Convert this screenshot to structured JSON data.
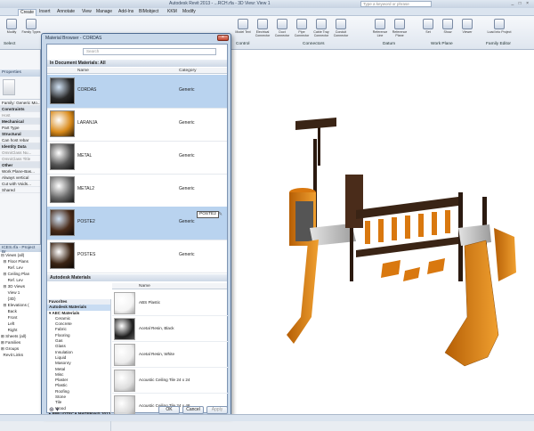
{
  "app": {
    "title": "Autodesk Revit 2013 - ...RCH.rfa - 3D View: View 1",
    "search_placeholder": "Type a keyword or phrase",
    "window_buttons": "_ □ ×"
  },
  "menu": [
    "Create",
    "Insert",
    "Annotate",
    "View",
    "Manage",
    "Add-Ins",
    "BIMobject",
    "KKM",
    "Modify"
  ],
  "ribbon": {
    "buttons": [
      "Modify",
      "Family Types",
      "",
      "",
      "Model Text",
      "Model Line",
      "Component",
      "Model Group",
      "Detail",
      "Symbolic Line",
      "Connector",
      "",
      "Electrical Connector",
      "Duct Connector",
      "Pipe Connector",
      "Cable Tray Connector",
      "Conduit Connector",
      "Reference Line",
      "Reference Plane",
      "Set",
      "Show",
      "Viewer",
      "Load into Project"
    ],
    "groups": [
      "Select",
      "Properties",
      "Control",
      "Connectors",
      "Datum",
      "Work Plane",
      "Family Editor"
    ]
  },
  "properties": {
    "header": "Properties",
    "type_selector": "Family: Generic Mo...",
    "rows": [
      {
        "t": "Constraints",
        "k": "sec"
      },
      {
        "t": "Host",
        "k": "gray"
      },
      {
        "t": "Mechanical",
        "k": "sec"
      },
      {
        "t": "Part Type",
        "k": ""
      },
      {
        "t": "Structural",
        "k": "sec"
      },
      {
        "t": "Can host rebar",
        "k": ""
      },
      {
        "t": "Identity Data",
        "k": "sec"
      },
      {
        "t": "OmniClass Nu...",
        "k": "gray"
      },
      {
        "t": "OmniClass Title",
        "k": "gray"
      },
      {
        "t": "Other",
        "k": "sec"
      },
      {
        "t": "Work Plane-Bas...",
        "k": ""
      },
      {
        "t": "Always vertical",
        "k": ""
      },
      {
        "t": "Cut with Voids...",
        "k": ""
      },
      {
        "t": "Shared",
        "k": ""
      }
    ],
    "help_link": "Properties help"
  },
  "project_browser": {
    "header": "ICES.rfa - Project Br",
    "items": [
      "⊟ Views (all)",
      "  ⊟ Floor Plans",
      "      Ref. Lev",
      "  ⊟ Ceiling Plan",
      "      Ref. Lev",
      "  ⊟ 3D Views",
      "      View 1",
      "      {3D}",
      "  ⊟ Elevations (",
      "      Back",
      "      Front",
      "      Left",
      "      Right",
      "⊞ Sheets (all)",
      "⊞ Families",
      "⊞ Groups",
      "  Revit Links"
    ]
  },
  "material_browser": {
    "title": "Material Browser - CORDAS",
    "close": "×",
    "search_placeholder": "Search",
    "doc_section": "In Document Materials: All",
    "col_name": "Name",
    "col_category": "Category",
    "doc_materials": [
      {
        "name": "CORDAS",
        "category": "Generic",
        "swatch": "#2a2a2a",
        "selected": true
      },
      {
        "name": "LARANJA",
        "category": "Generic",
        "swatch": "#d98a1a",
        "selected": false
      },
      {
        "name": "METAL",
        "category": "Generic",
        "swatch": "#555555",
        "selected": false
      },
      {
        "name": "METAL2",
        "category": "Generic",
        "swatch": "#6a6a6a",
        "selected": false
      },
      {
        "name": "POSTE2",
        "category": "Generic",
        "swatch": "#4a2c1a",
        "selected": true
      },
      {
        "name": "POSTES",
        "category": "Generic",
        "swatch": "#3b2414",
        "selected": false
      }
    ],
    "tooltip": "POSTE2",
    "lib_section": "Autodesk Materials",
    "lib_tree": [
      {
        "t": "Favorites",
        "k": "hdr"
      },
      {
        "t": "Autodesk Materials",
        "k": "hdr sel"
      },
      {
        "t": "▾ AEC Materials",
        "k": "b"
      },
      {
        "t": "Ceramic",
        "k": "sub"
      },
      {
        "t": "Concrete",
        "k": "sub"
      },
      {
        "t": "Fabric",
        "k": "sub"
      },
      {
        "t": "Flooring",
        "k": "sub"
      },
      {
        "t": "Gas",
        "k": "sub"
      },
      {
        "t": "Glass",
        "k": "sub"
      },
      {
        "t": "Insulation",
        "k": "sub"
      },
      {
        "t": "Liquid",
        "k": "sub"
      },
      {
        "t": "Masonry",
        "k": "sub"
      },
      {
        "t": "Metal",
        "k": "sub"
      },
      {
        "t": "Misc",
        "k": "sub"
      },
      {
        "t": "Plaster",
        "k": "sub"
      },
      {
        "t": "Plastic",
        "k": "sub"
      },
      {
        "t": "Roofing",
        "k": "sub"
      },
      {
        "t": "Stone",
        "k": "sub"
      },
      {
        "t": "Tile",
        "k": "sub"
      },
      {
        "t": "Wood",
        "k": "sub"
      },
      {
        "t": "▸ BIBLIOTECA MATERIAIS 2013",
        "k": "b"
      }
    ],
    "lib_materials": [
      {
        "name": "ABS Plastic",
        "swatch": "#f4f4f4"
      },
      {
        "name": "Acetal Resin, Black",
        "swatch": "#1e1e1e"
      },
      {
        "name": "Acetal Resin, White",
        "swatch": "#ececec"
      },
      {
        "name": "Acoustic Ceiling Tile 24 x 24",
        "swatch": "#dedede"
      },
      {
        "name": "Acoustic Ceiling Tile 24 x 48",
        "swatch": "#d8d8d8"
      }
    ],
    "buttons": {
      "ok": "OK",
      "cancel": "Cancel",
      "apply": "Apply"
    }
  },
  "colors": {
    "selection": "#b9d3ef",
    "orange": "#d9780f",
    "wood": "#4a2c1a"
  }
}
